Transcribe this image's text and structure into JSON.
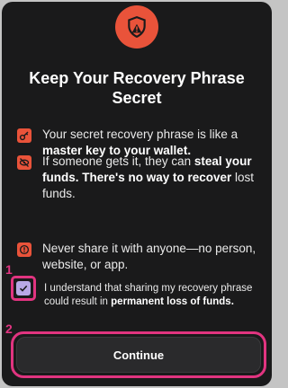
{
  "modal": {
    "hero_icon": "shield-warning-icon",
    "title": "Keep Your Recovery Phrase Secret"
  },
  "warnings": [
    {
      "icon": "key-icon",
      "text_pre": "Your secret recovery phrase is like a ",
      "text_bold": "master key to your wallet.",
      "text_post": ""
    },
    {
      "icon": "eye-off-icon",
      "text_pre": "If someone gets it, they can ",
      "text_bold": "steal your funds. There's no way to recover",
      "text_post": " lost funds."
    },
    {
      "icon": "alert-icon",
      "text_pre": "Never share it with anyone—no person, website, or app.",
      "text_bold": "",
      "text_post": ""
    }
  ],
  "acknowledge": {
    "checked": true,
    "text_pre": "I understand that sharing my recovery phrase could result in ",
    "text_bold": "permanent loss of funds."
  },
  "continue_label": "Continue",
  "markers": [
    "1",
    "2"
  ],
  "colors": {
    "accent": "#e9533a",
    "highlight": "#e13480",
    "checkbox": "#b8a8e6",
    "background": "#1a1a1b"
  }
}
